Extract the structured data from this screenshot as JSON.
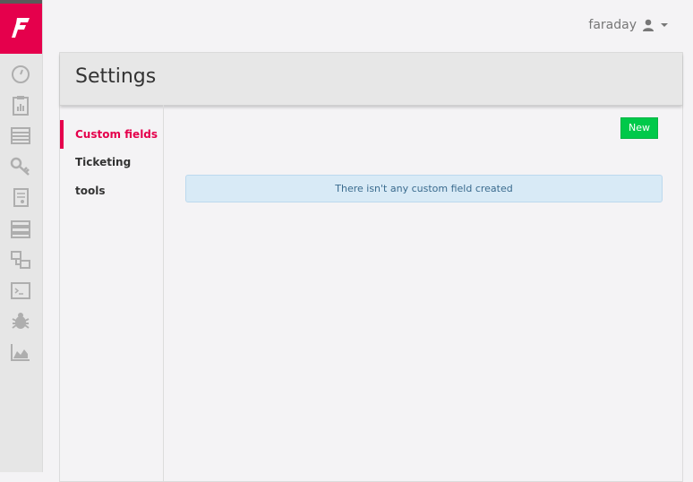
{
  "user": {
    "name": "faraday"
  },
  "panel": {
    "title": "Settings"
  },
  "subnav": {
    "items": [
      {
        "label": "Custom fields",
        "active": true
      },
      {
        "label": "Ticketing tools",
        "active": false
      }
    ]
  },
  "content": {
    "new_label": "New",
    "empty_message": "There isn't any custom field created"
  },
  "sidebar": {
    "icons": [
      "dashboard-gauge-icon",
      "clipboard-chart-icon",
      "list-icon",
      "key-icon",
      "document-icon",
      "server-stack-icon",
      "transfer-icon",
      "terminal-icon",
      "bug-icon",
      "area-chart-icon"
    ]
  },
  "colors": {
    "brand": "#e5004c",
    "new_button": "#00c94a",
    "alert_bg": "#d8eaf6",
    "alert_text": "#3a6b8e"
  }
}
